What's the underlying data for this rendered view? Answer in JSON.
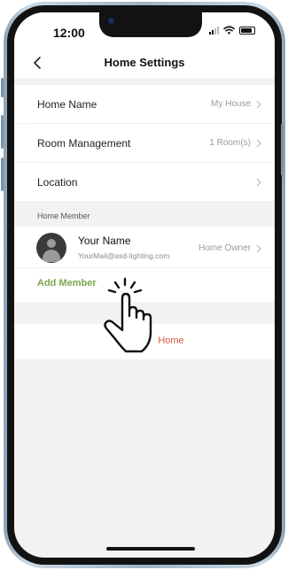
{
  "status_bar": {
    "time": "12:00"
  },
  "nav": {
    "title": "Home Settings"
  },
  "settings": {
    "home_name": {
      "label": "Home Name",
      "value": "My House"
    },
    "room_management": {
      "label": "Room Management",
      "value": "1 Room(s)"
    },
    "location": {
      "label": "Location"
    }
  },
  "members": {
    "section_label": "Home Member",
    "owner": {
      "name": "Your Name",
      "email": "YourMail@asd-lighting.com",
      "role": "Home Owner"
    },
    "add_label": "Add Member"
  },
  "remove": {
    "label": "Home"
  },
  "colors": {
    "accent_green": "#7ea64b",
    "danger_red": "#e05a4a",
    "background": "#f2f2f4"
  },
  "icons": [
    "back-arrow-icon",
    "chevron-right-icon",
    "signal-icon",
    "wifi-icon",
    "battery-icon",
    "avatar-icon",
    "pointing-hand-icon"
  ]
}
